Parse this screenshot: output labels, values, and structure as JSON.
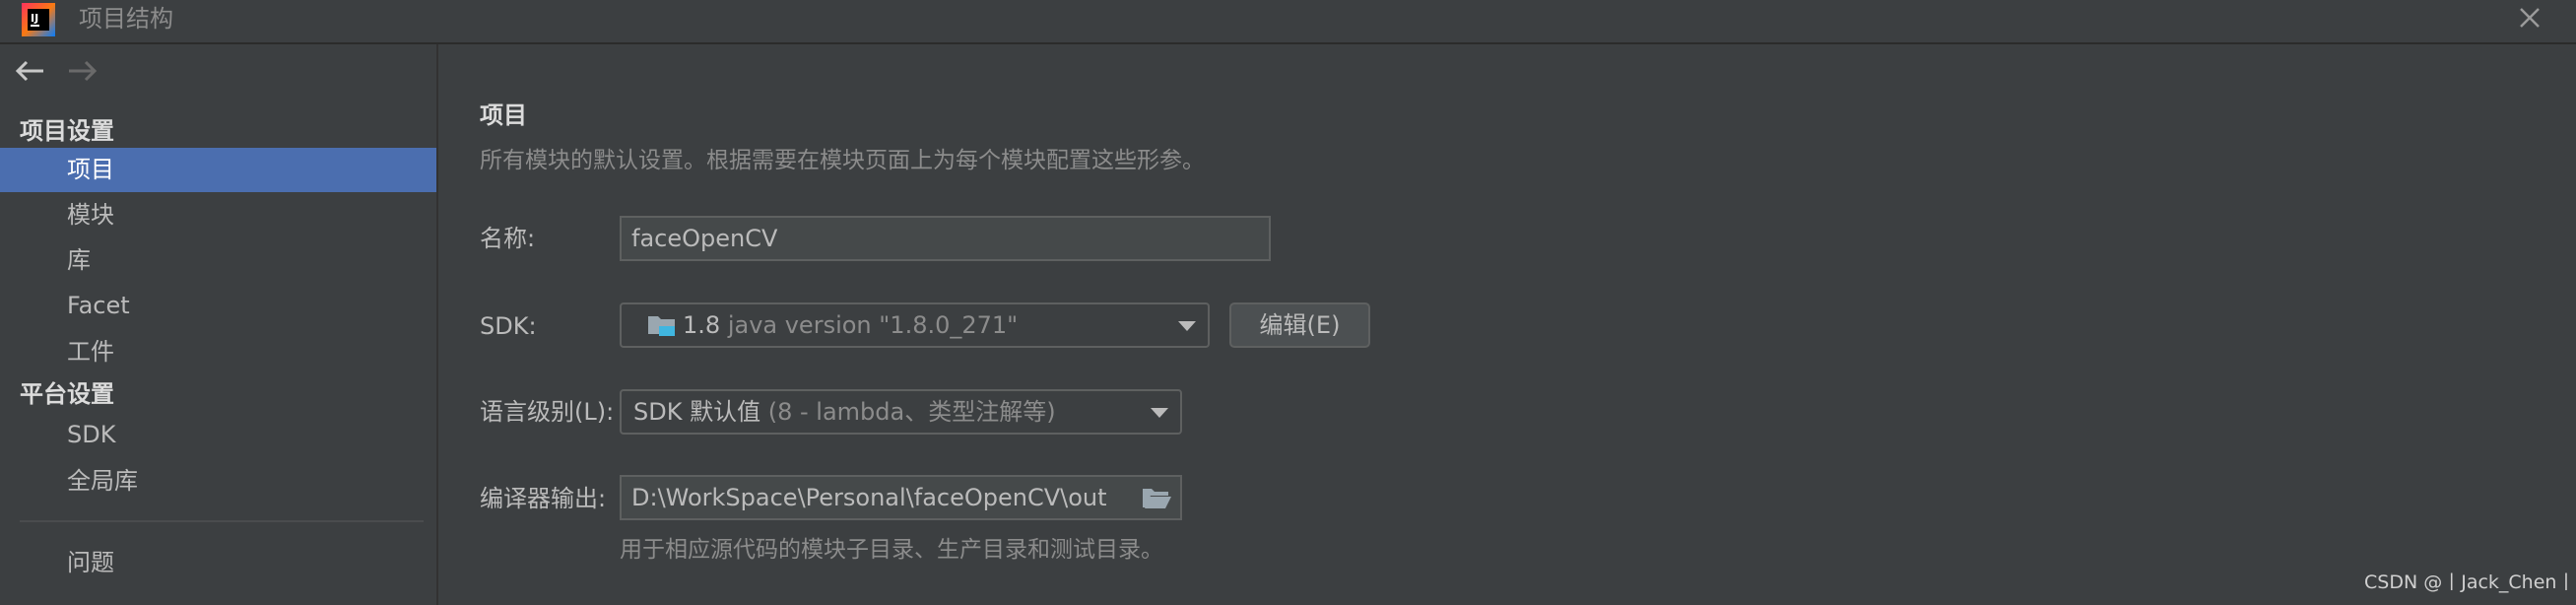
{
  "window": {
    "title": "项目结构",
    "app_icon": "intellij-idea-icon",
    "close_icon": "close-icon"
  },
  "nav": {
    "back_icon": "arrow-left-icon",
    "forward_icon": "arrow-right-icon"
  },
  "sidebar": {
    "project_settings_heading": "项目设置",
    "project_items": [
      {
        "label": "项目",
        "selected": true
      },
      {
        "label": "模块",
        "selected": false
      },
      {
        "label": "库",
        "selected": false
      },
      {
        "label": "Facet",
        "selected": false
      },
      {
        "label": "工件",
        "selected": false
      }
    ],
    "platform_settings_heading": "平台设置",
    "platform_items": [
      {
        "label": "SDK"
      },
      {
        "label": "全局库"
      }
    ],
    "problems_label": "问题"
  },
  "main": {
    "title": "项目",
    "description": "所有模块的默认设置。根据需要在模块页面上为每个模块配置这些形参。",
    "name_label": "名称:",
    "name_value": "faceOpenCV",
    "sdk_label": "SDK:",
    "sdk_icon": "folder-sdk-icon",
    "sdk_value": "1.8",
    "sdk_detail": "java version \"1.8.0_271\"",
    "edit_button": "编辑(E)",
    "lang_level_label": "语言级别(L):",
    "lang_level_value": "SDK 默认值",
    "lang_level_detail": "(8 - lambda、类型注解等)",
    "output_label": "编译器输出:",
    "output_value": "D:\\WorkSpace\\Personal\\faceOpenCV\\out",
    "output_folder_icon": "open-folder-icon",
    "output_hint": "用于相应源代码的模块子目录、生产目录和测试目录。"
  },
  "watermark": "CSDN @丨Jack_Chen丨",
  "colors": {
    "background": "#3c3f41",
    "selection": "#4b6eaf",
    "text": "#bbbbbb",
    "muted_text": "#8c8c8c"
  }
}
